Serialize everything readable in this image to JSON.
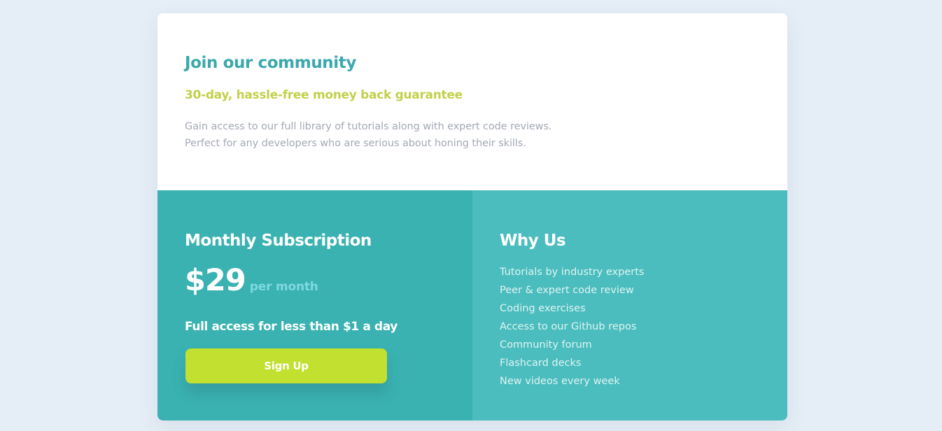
{
  "community": {
    "title": "Join our community",
    "subtitle": "30-day, hassle-free money back guarantee",
    "description_lines": [
      "Gain access to our full library of tutorials along with expert code reviews.",
      "Perfect for any developers who are serious about honing their skills."
    ]
  },
  "subscription": {
    "title": "Monthly Subscription",
    "price": "$29",
    "period": "per month",
    "tagline": "Full access for less than $1 a day",
    "button_label": "Sign Up"
  },
  "why_us": {
    "title": "Why Us",
    "items": [
      "Tutorials by industry experts",
      "Peer & expert code review",
      "Coding exercises",
      "Access to our Github repos",
      "Community forum",
      "Flashcard decks",
      "New videos every week"
    ]
  },
  "colors": {
    "page_background": "#e5edf6",
    "title_teal": "#3aa8ad",
    "subtitle_lime": "#c2d04a",
    "subscription_panel": "#3ab2b2",
    "why_panel": "#4bbdbe",
    "button": "#c1e030",
    "period_text": "#7fd8e2"
  }
}
